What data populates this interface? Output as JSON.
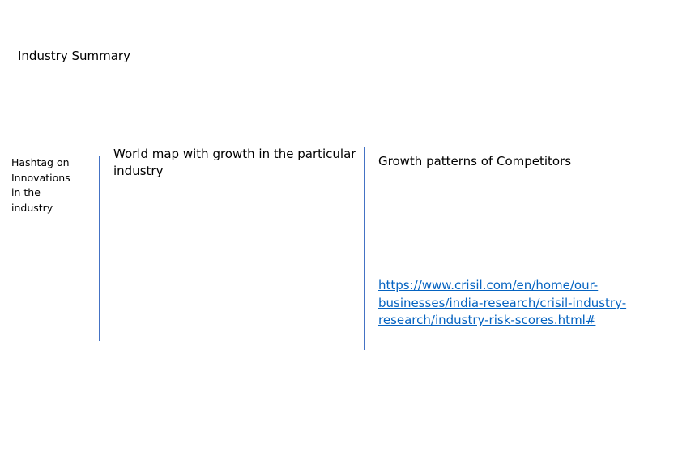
{
  "page": {
    "title": "Industry Summary"
  },
  "sidebar": {
    "note": "Hashtag on\nInnovations\nin the\nindustry"
  },
  "panels": {
    "map": {
      "heading": "World map with growth in the particular\nindustry"
    },
    "competitors": {
      "heading": "Growth patterns of Competitors",
      "link_text": "https://www.crisil.com/en/home/our-\nbusinesses/india-research/crisil-industry-\nresearch/industry-risk-scores.html#"
    }
  },
  "colors": {
    "rule": "#4472c4",
    "link": "#0563c1"
  }
}
